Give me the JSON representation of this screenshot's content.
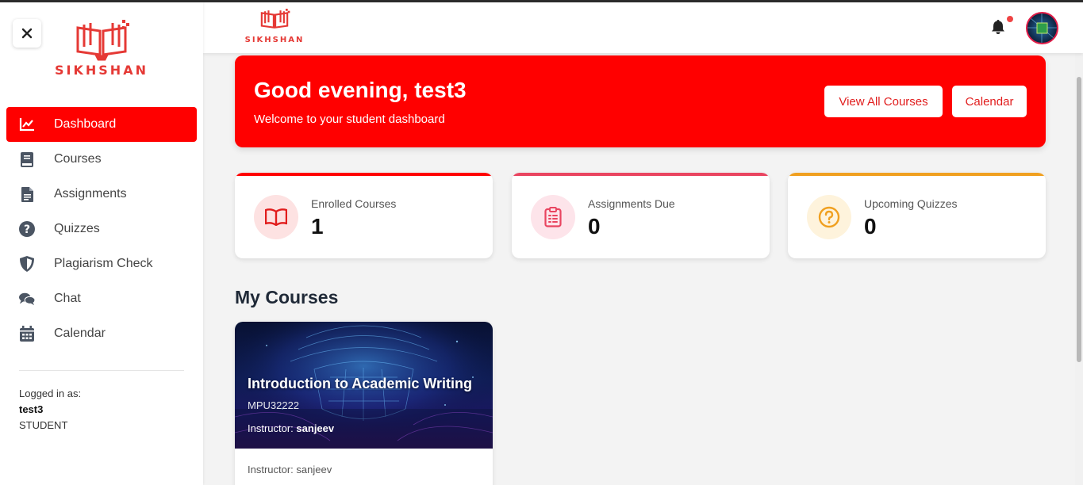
{
  "brand": {
    "name": "SIKHSHAN",
    "color": "#e53935"
  },
  "sidebar": {
    "items": [
      {
        "label": "Dashboard",
        "icon": "chart-line-icon",
        "active": true
      },
      {
        "label": "Courses",
        "icon": "book-icon",
        "active": false
      },
      {
        "label": "Assignments",
        "icon": "file-icon",
        "active": false
      },
      {
        "label": "Quizzes",
        "icon": "question-circle-icon",
        "active": false
      },
      {
        "label": "Plagiarism Check",
        "icon": "shield-icon",
        "active": false
      },
      {
        "label": "Chat",
        "icon": "chat-icon",
        "active": false
      },
      {
        "label": "Calendar",
        "icon": "calendar-icon",
        "active": false
      }
    ],
    "logged_in_label": "Logged in as:",
    "username": "test3",
    "role": "STUDENT"
  },
  "banner": {
    "greeting": "Good evening, test3",
    "subtitle": "Welcome to your student dashboard",
    "view_all_label": "View All Courses",
    "calendar_label": "Calendar"
  },
  "stats": [
    {
      "label": "Enrolled Courses",
      "value": "1",
      "icon": "open-book-icon",
      "accent": "#ff0000"
    },
    {
      "label": "Assignments Due",
      "value": "0",
      "icon": "clipboard-icon",
      "accent": "#e94560"
    },
    {
      "label": "Upcoming Quizzes",
      "value": "0",
      "icon": "question-circle-icon",
      "accent": "#f0a020"
    }
  ],
  "my_courses_title": "My Courses",
  "courses": [
    {
      "title": "Introduction to Academic Writing",
      "code": "MPU32222",
      "instructor_label": "Instructor:",
      "instructor": "sanjeev",
      "footer": "Instructor: sanjeev"
    }
  ],
  "colors": {
    "primary": "#ff0000",
    "background": "#f3f3f3"
  }
}
